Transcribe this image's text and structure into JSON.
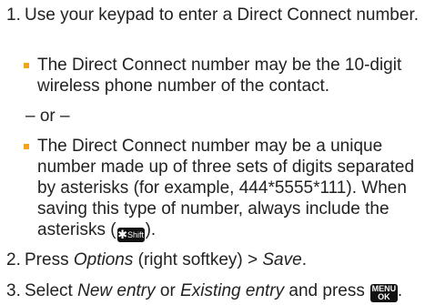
{
  "steps": [
    {
      "number": "1.",
      "text": "Use your keypad to enter a Direct Connect number.",
      "bullets": [
        "The Direct Connect number may be the 10-digit wireless phone number of the contact.",
        "The Direct Connect number may be a unique number made up of three sets of digits separated by asterisks (for example, 444*5555*111). When saving this type of number, always include the asterisks ("
      ],
      "separator": "– or –",
      "bullet_end": ")."
    },
    {
      "number": "2.",
      "pre": "Press ",
      "options_label": "Options",
      "mid": " (right softkey) > ",
      "save_label": "Save",
      "end": "."
    },
    {
      "number": "3.",
      "pre": "Select ",
      "new_entry_label": "New entry",
      "mid": " or ",
      "existing_entry_label": "Existing entry",
      "post": " and press",
      "end": "."
    }
  ],
  "keys": {
    "star_key": {
      "symbol": "✱",
      "sublabel": "Shift",
      "icon": "star-shift-key-icon"
    },
    "menu_key": {
      "top": "MENU",
      "bottom": "OK",
      "icon": "menu-ok-key-icon"
    }
  },
  "colors": {
    "bullet": "#f5a31a",
    "text": "#222222"
  }
}
